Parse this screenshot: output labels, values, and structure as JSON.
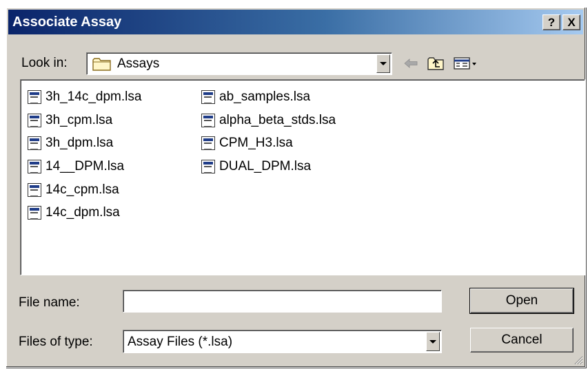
{
  "window": {
    "title": "Associate Assay",
    "help_label": "?",
    "close_label": "X"
  },
  "look_in": {
    "label": "Look in:",
    "value": "Assays",
    "icons": [
      "folder-icon",
      "back-arrow-icon",
      "up-folder-icon",
      "view-menu-icon"
    ]
  },
  "files": {
    "column1": [
      {
        "name": "3h_14c_dpm.lsa"
      },
      {
        "name": "3h_cpm.lsa"
      },
      {
        "name": "3h_dpm.lsa"
      },
      {
        "name": "14__DPM.lsa"
      },
      {
        "name": "14c_cpm.lsa"
      },
      {
        "name": "14c_dpm.lsa"
      }
    ],
    "column2": [
      {
        "name": "ab_samples.lsa"
      },
      {
        "name": "alpha_beta_stds.lsa"
      },
      {
        "name": "CPM_H3.lsa"
      },
      {
        "name": "DUAL_DPM.lsa"
      }
    ]
  },
  "file_name": {
    "label": "File name:",
    "value": ""
  },
  "file_type": {
    "label": "Files of type:",
    "value": "Assay Files (*.lsa)"
  },
  "buttons": {
    "open": "Open",
    "cancel": "Cancel"
  },
  "colors": {
    "dialog_face": "#d4d0c8",
    "title_gradient_start": "#0a246a",
    "title_gradient_end": "#a6caf0",
    "title_text": "#ffffff"
  }
}
